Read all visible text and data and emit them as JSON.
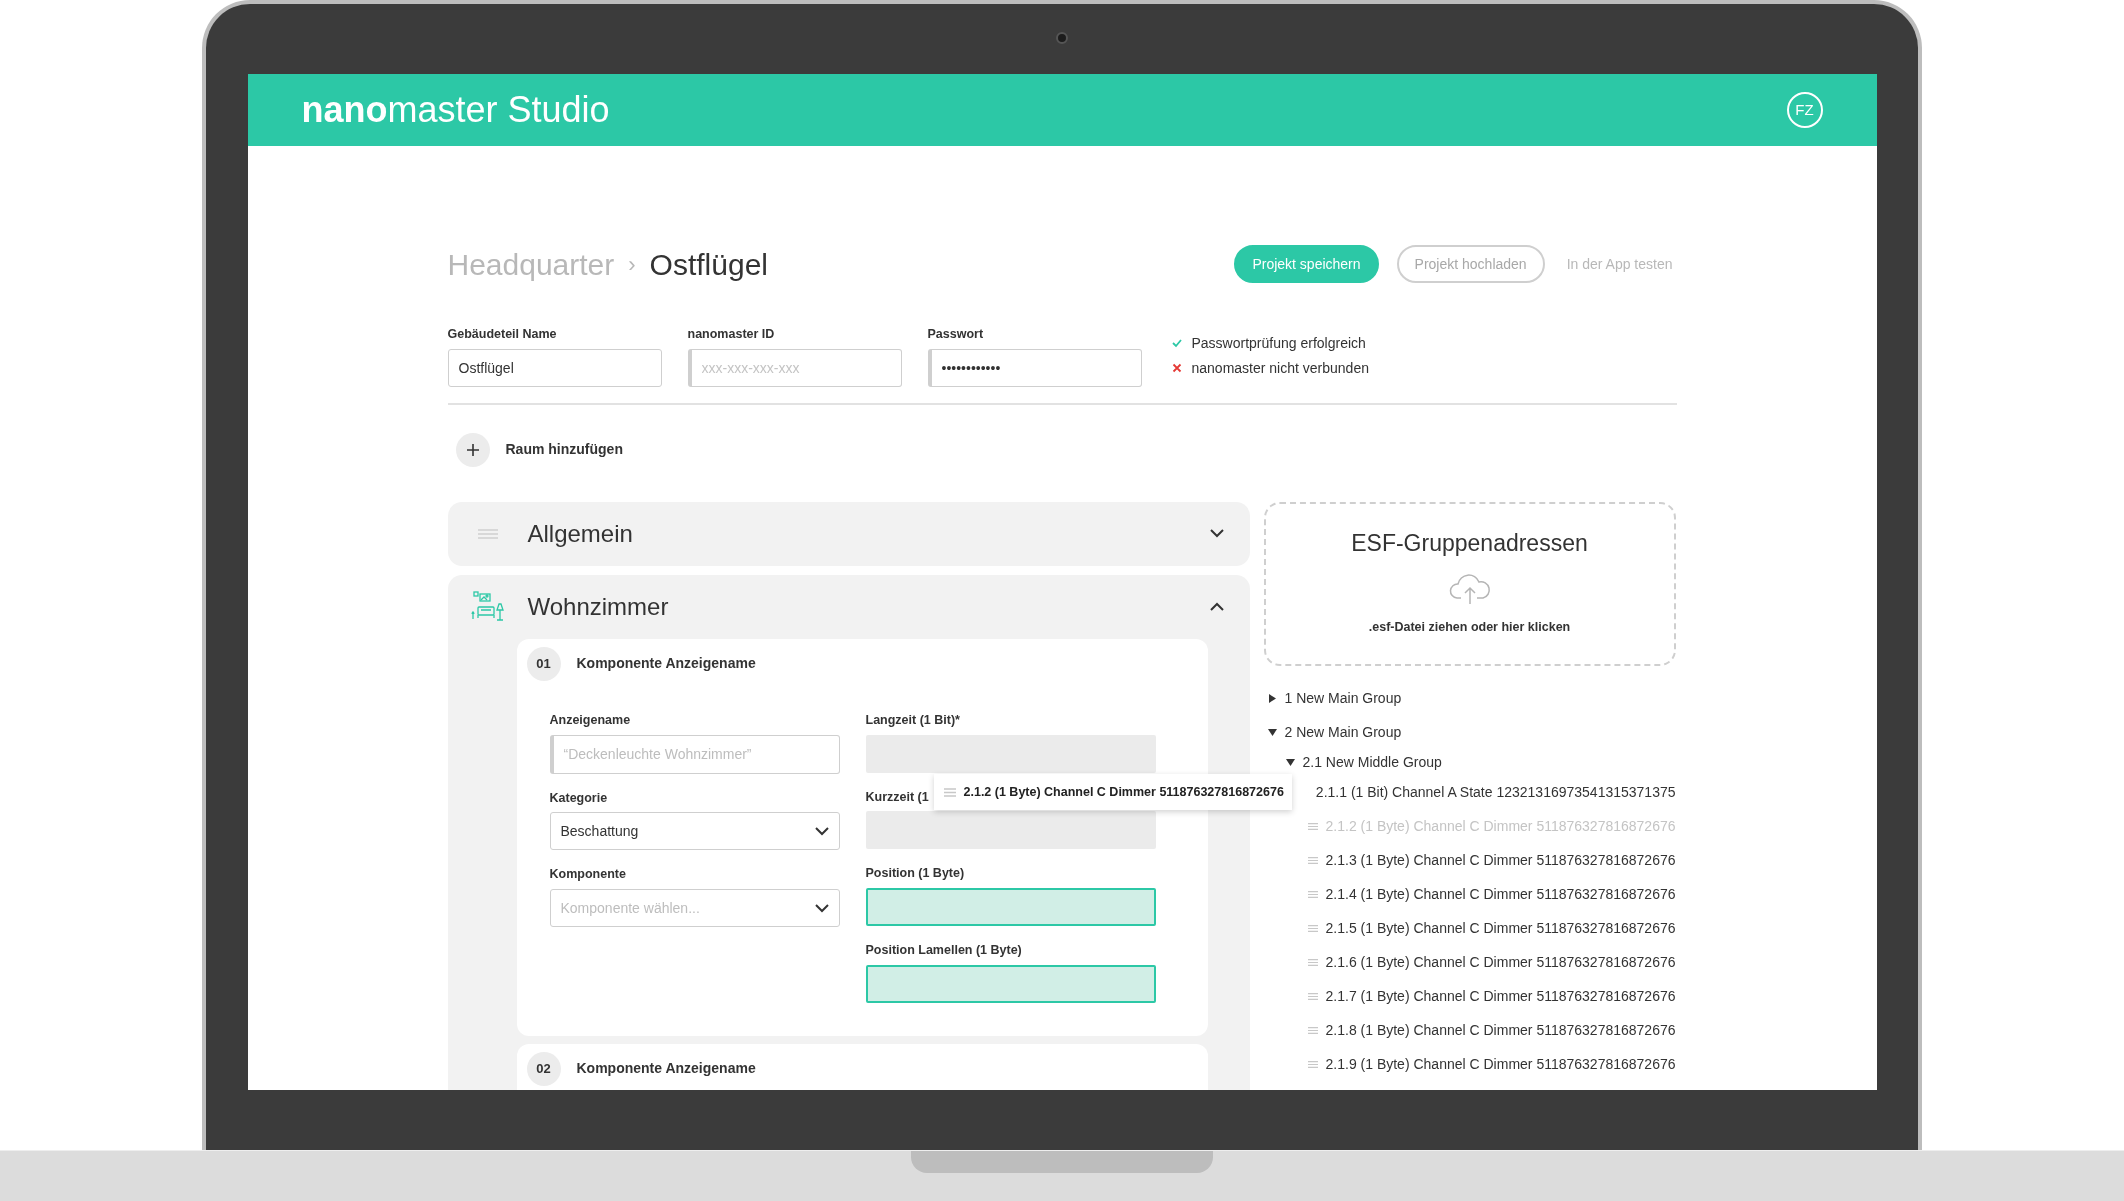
{
  "header": {
    "logo": "**nano**master Studio",
    "avatar": "FZ"
  },
  "breadcrumb": {
    "parent": "Headquarter",
    "separator": "›",
    "current": "Ostflügel"
  },
  "actions": [
    {
      "label": "Projekt speichern",
      "kind": "primary"
    },
    {
      "label": "Projekt hochladen",
      "kind": "outline"
    },
    {
      "label": "In der App testen",
      "kind": "link"
    }
  ],
  "fields": [
    {
      "label": "Gebäudeteil Name",
      "value": "Ostflügel"
    },
    {
      "label": "nanomaster ID",
      "placeholder": "xxx-xxx-xxx-xxx"
    },
    {
      "label": "Passwort",
      "value": "••••••••••••"
    }
  ],
  "status": [
    {
      "text": "Passwortprüfung erfolgreich",
      "ok": true
    },
    {
      "text": "nanomaster nicht verbunden",
      "ok": false
    }
  ],
  "add_room": {
    "label": "Raum hinzufügen"
  },
  "panels": [
    {
      "title": "Allgemein",
      "kind": "general",
      "expanded": false
    },
    {
      "title": "Wohnzimmer",
      "kind": "room",
      "expanded": true,
      "components": [
        {
          "number": "01",
          "title": "Komponente Anzeigename",
          "left": [
            {
              "label": "Anzeigename",
              "kind": "input",
              "placeholder": "“Deckenleuchte Wohnzimmer”"
            },
            {
              "label": "Kategorie",
              "kind": "select",
              "value": "Beschattung"
            },
            {
              "label": "Komponente",
              "kind": "select",
              "placeholder": "Komponente wählen..."
            }
          ],
          "right": [
            {
              "label": "Langzeit (1 Bit)*",
              "kind": "empty"
            },
            {
              "label": "Kurzzeit (1",
              "kind": "empty"
            },
            {
              "label": "Position (1 Byte)",
              "kind": "target"
            },
            {
              "label": "Position Lamellen (1 Byte)",
              "kind": "target"
            }
          ]
        },
        {
          "number": "02",
          "title": "Komponente Anzeigename"
        }
      ]
    }
  ],
  "esf": {
    "title": "ESF-Gruppenadressen",
    "hint": ".esf-Datei ziehen oder hier klicken"
  },
  "tree": [
    {
      "label": "1 New Main Group",
      "expanded": false
    },
    {
      "label": "2 New Main Group",
      "expanded": true,
      "children": [
        {
          "label": "2.1 New Middle Group",
          "expanded": true,
          "children": [
            {
              "label": "2.1.1 (1 Bit) Channel A State 12321316973541315371375",
              "dragging": false
            },
            {
              "label": "2.1.2 (1 Byte) Channel C Dimmer 511876327816872676",
              "dragging": true
            },
            {
              "label": "2.1.3 (1 Byte) Channel C Dimmer 511876327816872676",
              "dragging": false
            },
            {
              "label": "2.1.4 (1 Byte) Channel C Dimmer 511876327816872676",
              "dragging": false
            },
            {
              "label": "2.1.5 (1 Byte) Channel C Dimmer 511876327816872676",
              "dragging": false
            },
            {
              "label": "2.1.6 (1 Byte) Channel C Dimmer 511876327816872676",
              "dragging": false
            },
            {
              "label": "2.1.7 (1 Byte) Channel C Dimmer 511876327816872676",
              "dragging": false
            },
            {
              "label": "2.1.8 (1 Byte) Channel C Dimmer 511876327816872676",
              "dragging": false
            },
            {
              "label": "2.1.9 (1 Byte) Channel C Dimmer 511876327816872676",
              "dragging": false
            }
          ]
        }
      ]
    }
  ],
  "drag_item": {
    "label": "2.1.2 (1 Byte) Channel C Dimmer 511876327816872676"
  }
}
